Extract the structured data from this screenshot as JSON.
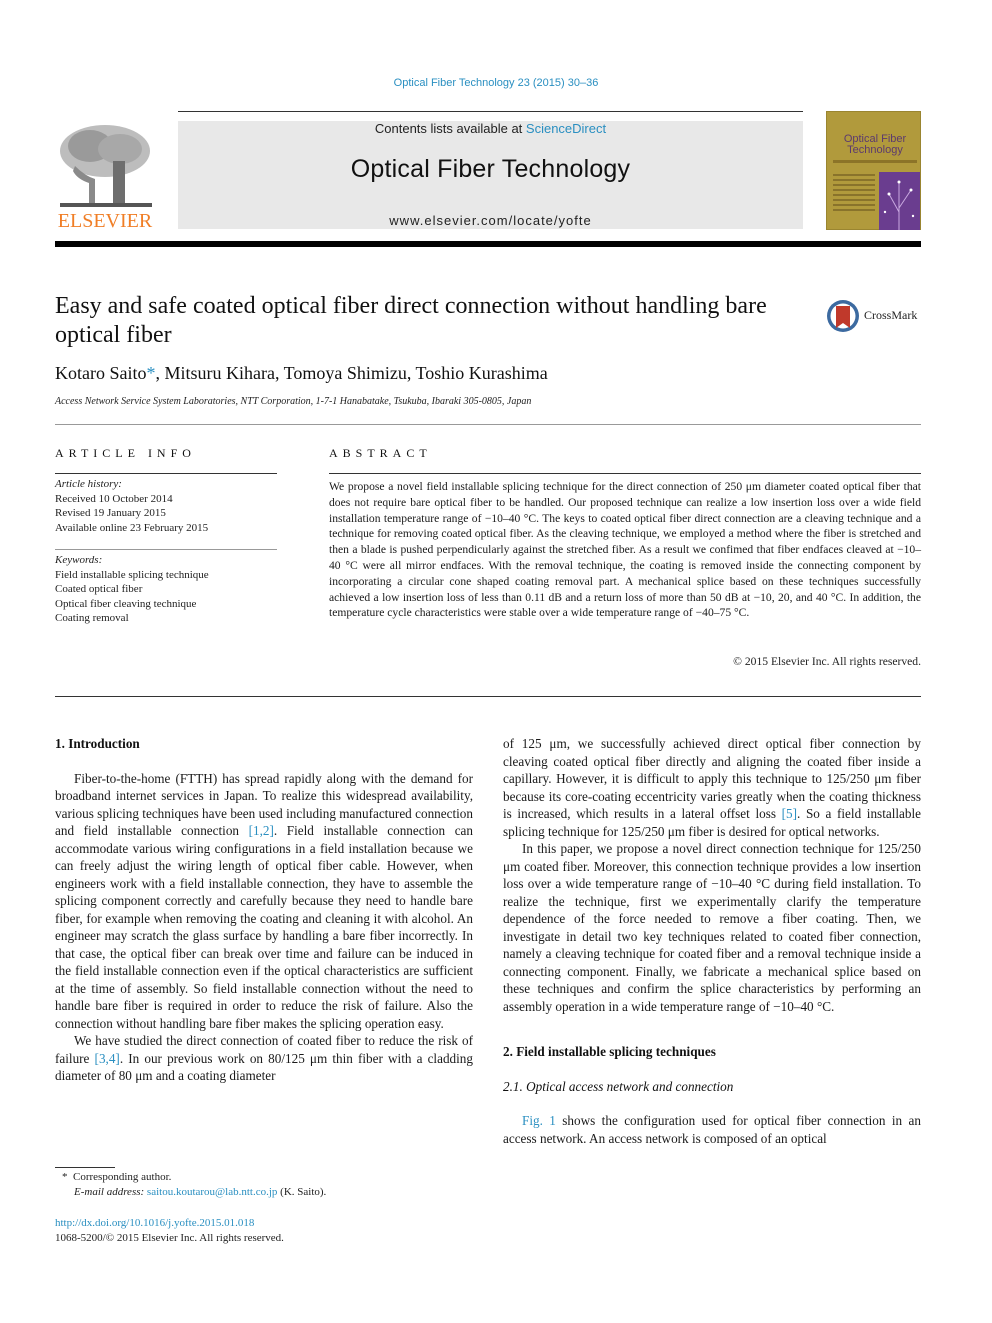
{
  "header": {
    "citation": "Optical Fiber Technology 23 (2015) 30–36",
    "contents_prefix": "Contents lists available at ",
    "contents_link": "ScienceDirect",
    "journal_title": "Optical Fiber Technology",
    "journal_url": "www.elsevier.com/locate/yofte",
    "publisher_logo_text": "ELSEVIER",
    "cover": {
      "title_line1": "Optical Fiber",
      "title_line2": "Technology"
    },
    "crossmark_label": "CrossMark"
  },
  "article": {
    "title": "Easy and safe coated optical fiber direct connection without handling bare optical fiber",
    "authors_first": "Kotaro Saito",
    "author_marker": "*",
    "authors_rest": ", Mitsuru Kihara, Tomoya Shimizu, Toshio Kurashima",
    "affiliation": "Access Network Service System Laboratories, NTT Corporation, 1-7-1 Hanabatake, Tsukuba, Ibaraki 305-0805, Japan"
  },
  "article_info": {
    "heading": "ARTICLE INFO",
    "history_label": "Article history:",
    "history": [
      "Received 10 October 2014",
      "Revised 19 January 2015",
      "Available online 23 February 2015"
    ],
    "keywords_label": "Keywords:",
    "keywords": [
      "Field installable splicing technique",
      "Coated optical fiber",
      "Optical fiber cleaving technique",
      "Coating removal"
    ]
  },
  "abstract": {
    "heading": "ABSTRACT",
    "text": "We propose a novel field installable splicing technique for the direct connection of 250 μm diameter coated optical fiber that does not require bare optical fiber to be handled. Our proposed technique can realize a low insertion loss over a wide field installation temperature range of −10–40 °C. The keys to coated optical fiber direct connection are a cleaving technique and a technique for removing coated optical fiber. As the cleaving technique, we employed a method where the fiber is stretched and then a blade is pushed perpendicularly against the stretched fiber. As a result we confimed that fiber endfaces cleaved at −10–40 °C were all mirror endfaces. With the removal technique, the coating is removed inside the connecting component by incorporating a circular cone shaped coating removal part. A mechanical splice based on these techniques successfully achieved a low insertion loss of less than 0.11 dB and a return loss of more than 50 dB at −10, 20, and 40 °C. In addition, the temperature cycle characteristics were stable over a wide temperature range of −40–75 °C.",
    "copyright": "© 2015 Elsevier Inc. All rights reserved."
  },
  "body": {
    "section1_heading": "1. Introduction",
    "p1_a": "Fiber-to-the-home (FTTH) has spread rapidly along with the demand for broadband internet services in Japan. To realize this widespread availability, various splicing techniques have been used including manufactured connection and field installable connection ",
    "p1_ref": "[1,2]",
    "p1_b": ". Field installable connection can accommodate various wiring configurations in a field installation because we can freely adjust the wiring length of optical fiber cable. However, when engineers work with a field installable connection, they have to assemble the splicing component correctly and carefully because they need to handle bare fiber, for example when removing the coating and cleaning it with alcohol. An engineer may scratch the glass surface by handling a bare fiber incorrectly. In that case, the optical fiber can break over time and failure can be induced in the field installable connection even if the optical characteristics are sufficient at the time of assembly. So field installable connection without the need to handle bare fiber is required in order to reduce the risk of failure. Also the connection without handling bare fiber makes the splicing operation easy.",
    "p2_a": "We have studied the direct connection of coated fiber to reduce the risk of failure ",
    "p2_ref": "[3,4]",
    "p2_b": ". In our previous work on 80/125 μm thin fiber with a cladding diameter of 80 μm and a coating diameter",
    "p2_c": "of 125 μm, we successfully achieved direct optical fiber connection by cleaving coated optical fiber directly and aligning the coated fiber inside a capillary. However, it is difficult to apply this technique to 125/250 μm fiber because its core-coating eccentricity varies greatly when the coating thickness is increased, which results in a lateral offset loss ",
    "p2_ref2": "[5]",
    "p2_d": ". So a field installable splicing technique for 125/250 μm fiber is desired for optical networks.",
    "p3": "In this paper, we propose a novel direct connection technique for 125/250 μm coated fiber. Moreover, this connection technique provides a low insertion loss over a wide temperature range of −10–40 °C during field installation. To realize the technique, first we experimentally clarify the temperature dependence of the force needed to remove a fiber coating. Then, we investigate in detail two key techniques related to coated fiber connection, namely a cleaving technique for coated fiber and a removal technique inside a connecting component. Finally, we fabricate a mechanical splice based on these techniques and confirm the splice characteristics by performing an assembly operation in a wide temperature range of −10–40 °C.",
    "section2_heading": "2. Field installable splicing techniques",
    "subsection21_heading": "2.1. Optical access network and connection",
    "p4_ref": "Fig. 1",
    "p4_text": " shows the configuration used for optical fiber connection in an access network. An access network is composed of an optical"
  },
  "footnotes": {
    "marker": "*",
    "corresponding": "Corresponding author.",
    "email_label": "E-mail address: ",
    "email": "saitou.koutarou@lab.ntt.co.jp",
    "email_suffix": " (K. Saito).",
    "doi": "http://dx.doi.org/10.1016/j.yofte.2015.01.018",
    "issn_line": "1068-5200/© 2015 Elsevier Inc. All rights reserved."
  }
}
